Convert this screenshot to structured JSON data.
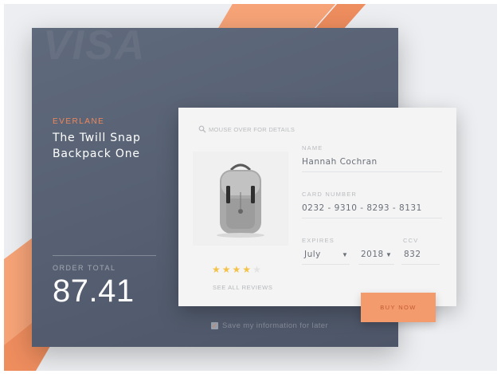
{
  "card": {
    "logo_text": "VISA",
    "brand": "EVERLANE",
    "product_name": "The Twill Snap Backpack One",
    "order_total_label": "ORDER TOTAL",
    "order_total_value": "87.41",
    "save_label": "Save my information for later",
    "save_checked": true
  },
  "form": {
    "hint": "MOUSE OVER FOR DETAILS",
    "rating": {
      "value": 4,
      "max": 5
    },
    "reviews_link": "SEE ALL REVIEWS",
    "name_label": "NAME",
    "name_value": "Hannah Cochran",
    "card_number_label": "CARD NUMBER",
    "card_number_value": "0232 - 9310 - 8293 - 8131",
    "expires_label": "EXPIRES",
    "expires_month": "July",
    "expires_year": "2018",
    "ccv_label": "CCV",
    "ccv_value": "832",
    "buy_label": "BUY NOW"
  },
  "icons": {
    "hint": "search-icon",
    "select": "caret-down-icon",
    "product": "backpack-image"
  },
  "colors": {
    "accent": "#f39b6d",
    "brand_text": "#f0875a",
    "card_bg": "#5a6476",
    "star": "#f3c248"
  }
}
